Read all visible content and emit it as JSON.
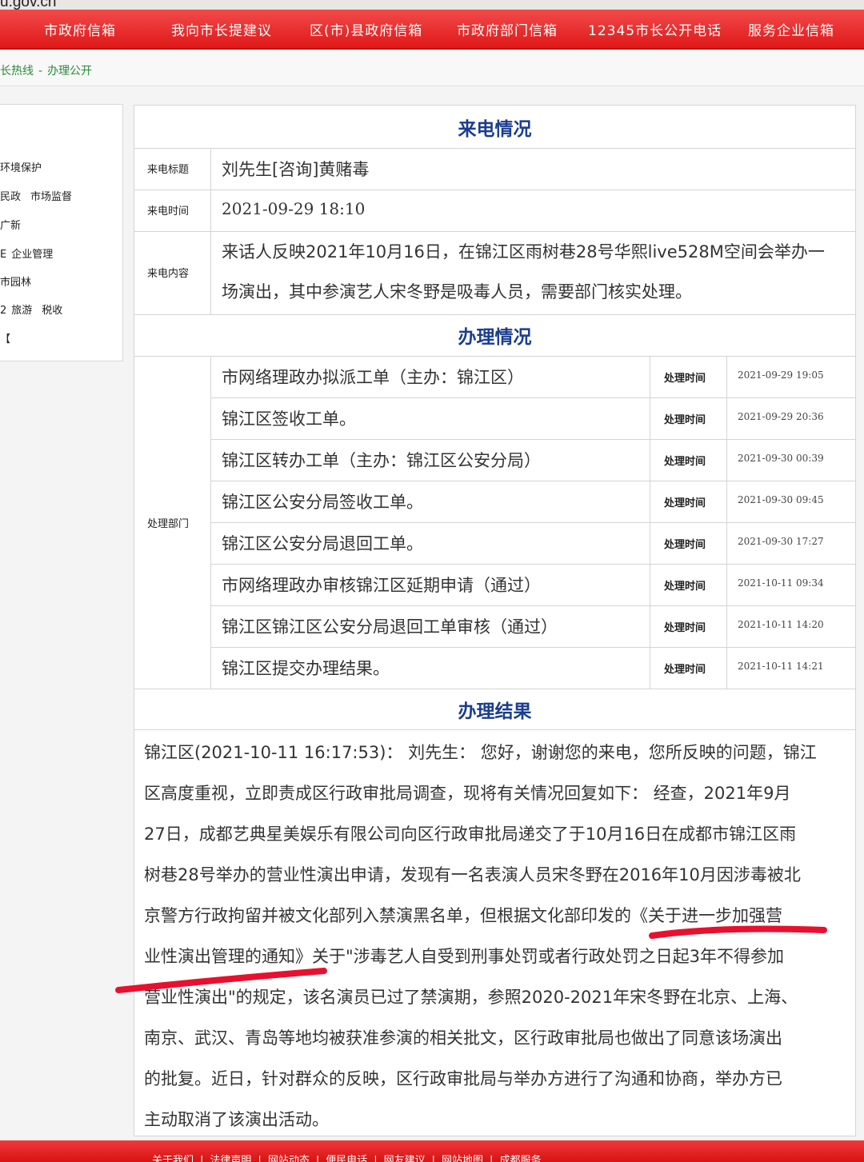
{
  "site": {
    "domain_fragment": "u.gov.cn"
  },
  "nav": {
    "items": [
      "市政府信箱",
      "我向市长提建议",
      "区(市)县政府信箱",
      "市政府部门信箱",
      "12345市长公开电话",
      "服务企业信箱"
    ]
  },
  "breadcrumb": {
    "first": "长热线",
    "separator": "-",
    "second": "办理公开"
  },
  "sidebar": {
    "rows": [
      [
        "环境保护"
      ],
      [
        "民政",
        "市场监督"
      ],
      [
        "广新"
      ],
      [
        "E",
        "企业管理"
      ],
      [
        "市园林"
      ],
      [
        "2",
        "旅游",
        "税收"
      ],
      [
        "【"
      ]
    ]
  },
  "call": {
    "heading": "来电情况",
    "title_label": "来电标题",
    "title_value": "刘先生[咨询]黄赌毒",
    "time_label": "来电时间",
    "time_value": "2021-09-29 18:10",
    "content_label": "来电内容",
    "content_line1": "来话人反映2021年10月16日，在锦江区雨树巷28号华熙live528M空间会举办一",
    "content_line2": "场演出，其中参演艺人宋冬野是吸毒人员，需要部门核实处理。"
  },
  "processing": {
    "heading": "办理情况",
    "dept_label": "处理部门",
    "time_label": "处理时间",
    "steps": [
      {
        "desc": "市网络理政办拟派工单（主办：锦江区）",
        "time": "2021-09-29 19:05"
      },
      {
        "desc": "锦江区签收工单。",
        "time": "2021-09-29 20:36"
      },
      {
        "desc": "锦江区转办工单（主办：锦江区公安分局）",
        "time": "2021-09-30 00:39"
      },
      {
        "desc": "锦江区公安分局签收工单。",
        "time": "2021-09-30 09:45"
      },
      {
        "desc": "锦江区公安分局退回工单。",
        "time": "2021-09-30 17:27"
      },
      {
        "desc": "市网络理政办审核锦江区延期申请（通过）",
        "time": "2021-10-11 09:34"
      },
      {
        "desc": "锦江区锦江区公安分局退回工单审核（通过）",
        "time": "2021-10-11 14:20"
      },
      {
        "desc": "锦江区提交办理结果。",
        "time": "2021-10-11 14:21"
      }
    ]
  },
  "result": {
    "heading": "办理结果",
    "lines": [
      "锦江区(2021-10-11 16:17:53)：  刘先生：  您好，谢谢您的来电，您所反映的问题，锦江",
      "区高度重视，立即责成区行政审批局调查，现将有关情况回复如下：  经查，2021年9月",
      "27日，成都艺典星美娱乐有限公司向区行政审批局递交了于10月16日在成都市锦江区雨",
      "树巷28号举办的营业性演出申请，发现有一名表演人员宋冬野在2016年10月因涉毒被北",
      "京警方行政拘留并被文化部列入禁演黑名单，但根据文化部印发的《关于进一步加强营",
      "业性演出管理的通知》关于\"涉毒艺人自受到刑事处罚或者行政处罚之日起3年不得参加",
      "营业性演出\"的规定，该名演员已过了禁演期，参照2020-2021年宋冬野在北京、上海、",
      "南京、武汉、青岛等地均被获准参演的相关批文，区行政审批局也做出了同意该场演出",
      "的批复。近日，针对群众的反映，区行政审批局与举办方进行了沟通和协商，举办方已",
      "主动取消了该演出活动。"
    ]
  },
  "footer": {
    "links": [
      "关于我们",
      "法律声明",
      "网站动态",
      "便民电话",
      "网友建议",
      "网站地图",
      "成都服务"
    ],
    "separator": "|"
  },
  "colors": {
    "nav_red": "#e01818",
    "heading_blue": "#1a3d8f",
    "crumb_green": "#2a8a3a",
    "marker_red": "#e8102e"
  }
}
